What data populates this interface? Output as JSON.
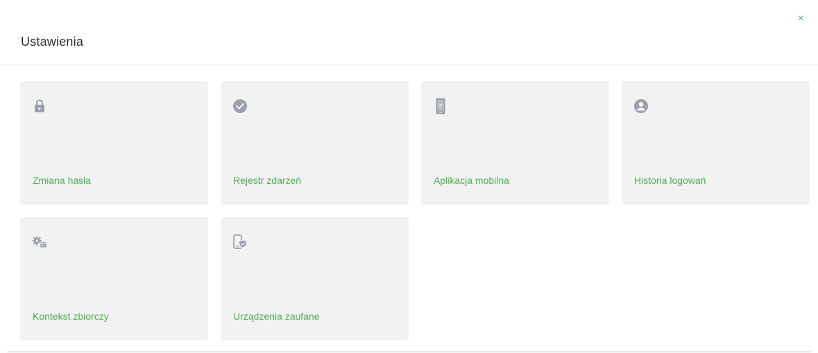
{
  "dialog": {
    "title": "Ustawienia",
    "close_label": "×",
    "accent_color": "#4caf50",
    "icon_color": "#9ba1aa",
    "tile_background": "#f2f2f2"
  },
  "tiles": [
    {
      "label": "Zmiana hasła",
      "icon": "lock-icon"
    },
    {
      "label": "Rejestr zdarzeń",
      "icon": "check-circle-icon"
    },
    {
      "label": "Aplikacja mobilna",
      "icon": "mobile-phone-icon"
    },
    {
      "label": "Historia logowań",
      "icon": "user-circle-icon"
    },
    {
      "label": "Kontekst zbiorczy",
      "icon": "gear-group-icon"
    },
    {
      "label": "Urządzenia zaufane",
      "icon": "trusted-device-icon"
    }
  ]
}
